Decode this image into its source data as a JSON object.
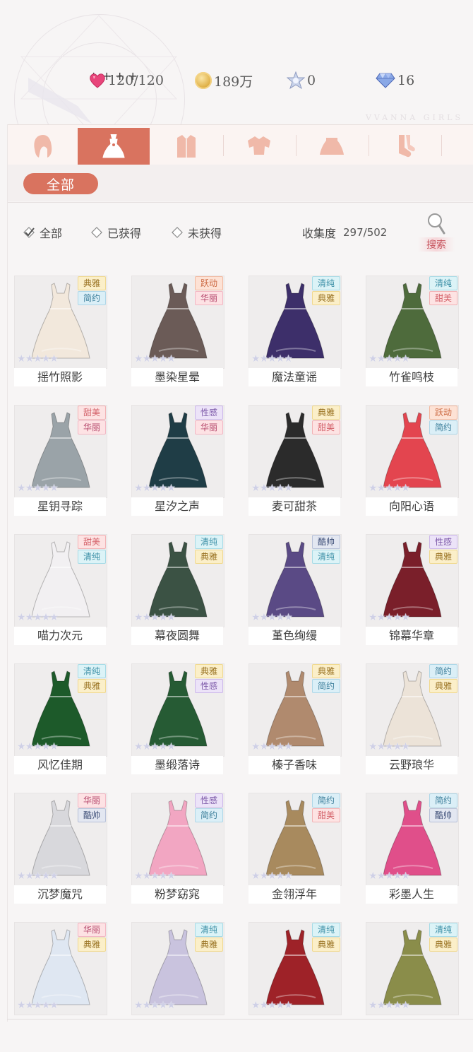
{
  "watermark": "VVANNA GIRLS",
  "currency": {
    "stamina": "120/120",
    "gold": "189万",
    "stars": "0",
    "diamonds": "16",
    "plus": "+"
  },
  "tabs": [
    {
      "icon": "hair-icon",
      "active": false
    },
    {
      "icon": "dress-icon",
      "active": true
    },
    {
      "icon": "coat-icon",
      "active": false
    },
    {
      "icon": "top-icon",
      "active": false
    },
    {
      "icon": "skirt-icon",
      "active": false
    },
    {
      "icon": "socks-icon",
      "active": false
    }
  ],
  "filter_pill": "全部",
  "options": {
    "all": "全部",
    "owned": "已获得",
    "not_owned": "未获得",
    "collection_label": "收集度",
    "collection_count": "297/502",
    "search": "搜索"
  },
  "items": [
    {
      "name": "摇竹照影",
      "tags": [
        "典雅",
        "简约"
      ],
      "rarity": 5
    },
    {
      "name": "墨染星晕",
      "tags": [
        "跃动",
        "华丽"
      ],
      "rarity": 5
    },
    {
      "name": "魔法童谣",
      "tags": [
        "清纯",
        "典雅"
      ],
      "rarity": 5
    },
    {
      "name": "竹雀鸣枝",
      "tags": [
        "清纯",
        "甜美"
      ],
      "rarity": 5
    },
    {
      "name": "星钥寻踪",
      "tags": [
        "甜美",
        "华丽"
      ],
      "rarity": 5
    },
    {
      "name": "星汐之声",
      "tags": [
        "性感",
        "华丽"
      ],
      "rarity": 5
    },
    {
      "name": "麦可甜茶",
      "tags": [
        "典雅",
        "甜美"
      ],
      "rarity": 5
    },
    {
      "name": "向阳心语",
      "tags": [
        "跃动",
        "简约"
      ],
      "rarity": 5
    },
    {
      "name": "喵力次元",
      "tags": [
        "甜美",
        "清纯"
      ],
      "rarity": 5
    },
    {
      "name": "幕夜圆舞",
      "tags": [
        "清纯",
        "典雅"
      ],
      "rarity": 5
    },
    {
      "name": "堇色绚缦",
      "tags": [
        "酷帅",
        "清纯"
      ],
      "rarity": 5
    },
    {
      "name": "锦幕华章",
      "tags": [
        "性感",
        "典雅"
      ],
      "rarity": 5
    },
    {
      "name": "风忆佳期",
      "tags": [
        "清纯",
        "典雅"
      ],
      "rarity": 5
    },
    {
      "name": "墨缎落诗",
      "tags": [
        "典雅",
        "性感"
      ],
      "rarity": 5
    },
    {
      "name": "榛子香味",
      "tags": [
        "典雅",
        "简约"
      ],
      "rarity": 5
    },
    {
      "name": "云野琅华",
      "tags": [
        "简约",
        "典雅"
      ],
      "rarity": 5
    },
    {
      "name": "沉梦魔咒",
      "tags": [
        "华丽",
        "酷帅"
      ],
      "rarity": 5
    },
    {
      "name": "粉梦窈窕",
      "tags": [
        "性感",
        "简约"
      ],
      "rarity": 5
    },
    {
      "name": "金翎浮年",
      "tags": [
        "简约",
        "甜美"
      ],
      "rarity": 5
    },
    {
      "name": "彩墨人生",
      "tags": [
        "简约",
        "酷帅"
      ],
      "rarity": 5
    },
    {
      "name": "",
      "tags": [
        "华丽",
        "典雅"
      ],
      "rarity": 5
    },
    {
      "name": "",
      "tags": [
        "清纯",
        "典雅"
      ],
      "rarity": 5
    },
    {
      "name": "",
      "tags": [
        "清纯",
        "典雅"
      ],
      "rarity": 5
    },
    {
      "name": "",
      "tags": [
        "清纯",
        "典雅"
      ],
      "rarity": 5
    }
  ],
  "colors": {
    "accent": "#d9735f",
    "plus": "#4a8a80",
    "dresses": [
      "#f2e8dc",
      "#6b5b57",
      "#3d2f6a",
      "#4e6b3c",
      "#9aa3a8",
      "#1f3d46",
      "#2b2b2b",
      "#e3454f",
      "#f2f0f2",
      "#3b5244",
      "#5a4a85",
      "#7a1f2a",
      "#1d5a2a",
      "#265b34",
      "#b08a6e",
      "#ece3d8",
      "#d8d8dc",
      "#f2a6c2",
      "#a88a5e",
      "#e04f8a",
      "#dfe7f2",
      "#c9c3de",
      "#9e2228",
      "#8a8d4a"
    ]
  }
}
